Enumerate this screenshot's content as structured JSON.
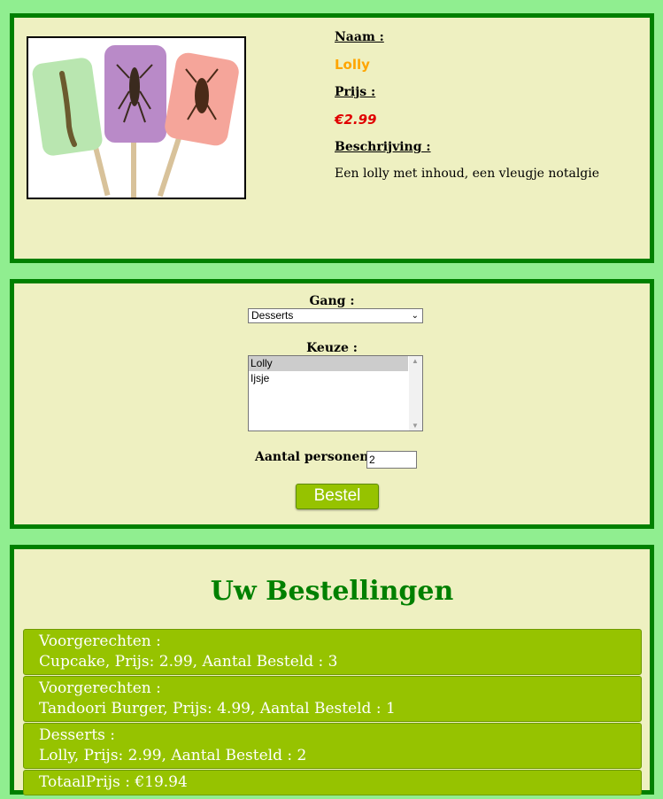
{
  "product": {
    "name_label": "Naam :",
    "name": "Lolly",
    "price_label": "Prijs :",
    "price": "€2.99",
    "desc_label": "Beschrijving :",
    "description": "Een lolly met inhoud, een vleugje notalgie"
  },
  "form": {
    "course_label": "Gang :",
    "course_selected": "Desserts",
    "choice_label": "Keuze :",
    "choices": [
      "Lolly",
      "Ijsje"
    ],
    "choice_selected": "Lolly",
    "persons_label": "Aantal personen :",
    "persons_value": "2",
    "order_button": "Bestel"
  },
  "orders": {
    "title": "Uw Bestellingen",
    "items": [
      {
        "course": "Voorgerechten :",
        "line": "Cupcake, Prijs: 2.99, Aantal Besteld : 3"
      },
      {
        "course": "Voorgerechten :",
        "line": "Tandoori Burger, Prijs: 4.99, Aantal Besteld : 1"
      },
      {
        "course": "Desserts :",
        "line": "Lolly, Prijs: 2.99, Aantal Besteld : 2"
      }
    ],
    "total": "TotaalPrijs : €19.94"
  },
  "colors": {
    "page_bg": "#90ee90",
    "panel_bg": "#eef0c1",
    "panel_border": "#008000",
    "accent_green": "#96c300",
    "name_color": "#ffa500",
    "price_color": "#e00000"
  }
}
